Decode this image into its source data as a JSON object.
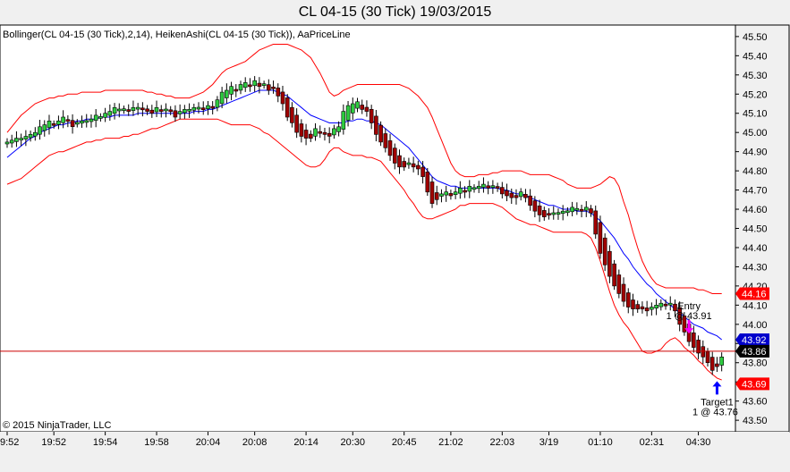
{
  "window": {
    "title": "CL 04-15 (30 Tick)  19/03/2015"
  },
  "indicators_label": "Bollinger(CL 04-15 (30 Tick),2,14), HeikenAshi(CL 04-15 (30 Tick)), AaPriceLine",
  "copyright": "© 2015 NinjaTrader, LLC",
  "colors": {
    "panel_bg": "#ffffff",
    "frame_bg": "#f0f0f0",
    "bull_body": "#2ecc40",
    "bear_body": "#a00000",
    "bollinger_band": "#ff0000",
    "bollinger_mid": "#0000ff",
    "price_line": "#cc0000",
    "entry_arrow": "#ff00ff",
    "target_arrow": "#0000ff"
  },
  "chart_data": {
    "type": "candlestick",
    "title": "CL 04-15 (30 Tick)  19/03/2015",
    "ylim": [
      43.44,
      45.56
    ],
    "y_ticks": [
      45.5,
      45.4,
      45.3,
      45.2,
      45.1,
      45.0,
      44.9,
      44.8,
      44.7,
      44.6,
      44.5,
      44.4,
      44.3,
      44.2,
      44.1,
      44.0,
      43.9,
      43.8,
      43.7,
      43.6,
      43.5
    ],
    "x_ticks": [
      {
        "label": "9:52",
        "bar": 0
      },
      {
        "label": "19:52",
        "bar": 10
      },
      {
        "label": "19:54",
        "bar": 21
      },
      {
        "label": "19:58",
        "bar": 32
      },
      {
        "label": "20:04",
        "bar": 43
      },
      {
        "label": "20:08",
        "bar": 53
      },
      {
        "label": "20:14",
        "bar": 64
      },
      {
        "label": "20:30",
        "bar": 74
      },
      {
        "label": "20:45",
        "bar": 85
      },
      {
        "label": "21:02",
        "bar": 95
      },
      {
        "label": "22:03",
        "bar": 106
      },
      {
        "label": "3/19",
        "bar": 116
      },
      {
        "label": "01:10",
        "bar": 127
      },
      {
        "label": "02:31",
        "bar": 138
      },
      {
        "label": "04:30",
        "bar": 148
      }
    ],
    "ha_close": [
      44.95,
      44.96,
      44.97,
      44.97,
      44.98,
      44.99,
      45.0,
      45.03,
      45.04,
      45.06,
      45.04,
      45.06,
      45.08,
      45.06,
      45.03,
      45.05,
      45.06,
      45.06,
      45.07,
      45.09,
      45.08,
      45.1,
      45.11,
      45.13,
      45.12,
      45.12,
      45.11,
      45.13,
      45.13,
      45.12,
      45.11,
      45.1,
      45.13,
      45.11,
      45.12,
      45.11,
      45.08,
      45.11,
      45.12,
      45.12,
      45.13,
      45.13,
      45.12,
      45.14,
      45.13,
      45.17,
      45.21,
      45.22,
      45.24,
      45.22,
      45.25,
      45.26,
      45.24,
      45.27,
      45.24,
      45.25,
      45.22,
      45.23,
      45.19,
      45.15,
      45.08,
      45.05,
      45.0,
      44.98,
      44.97,
      44.97,
      45.02,
      45.0,
      44.99,
      44.98,
      45.02,
      45.03,
      45.11,
      45.14,
      45.15,
      45.16,
      45.12,
      45.11,
      45.05,
      44.99,
      44.95,
      44.92,
      44.88,
      44.84,
      44.82,
      44.82,
      44.84,
      44.82,
      44.81,
      44.77,
      44.69,
      44.63,
      44.65,
      44.68,
      44.69,
      44.67,
      44.69,
      44.71,
      44.69,
      44.72,
      44.71,
      44.72,
      44.73,
      44.71,
      44.72,
      44.71,
      44.68,
      44.67,
      44.66,
      44.66,
      44.69,
      44.66,
      44.62,
      44.59,
      44.57,
      44.56,
      44.57,
      44.58,
      44.58,
      44.59,
      44.59,
      44.61,
      44.6,
      44.59,
      44.61,
      44.58,
      44.47,
      44.37,
      44.31,
      44.25,
      44.2,
      44.16,
      44.12,
      44.09,
      44.08,
      44.08,
      44.08,
      44.07,
      44.09,
      44.1,
      44.11,
      44.1,
      44.11,
      44.07,
      44.0,
      43.96,
      43.91,
      43.88,
      43.85,
      43.83,
      43.8,
      43.76,
      43.78,
      43.83
    ],
    "bb_upper": [
      45.0,
      45.03,
      45.06,
      45.09,
      45.11,
      45.13,
      45.15,
      45.16,
      45.17,
      45.18,
      45.18,
      45.19,
      45.19,
      45.2,
      45.2,
      45.2,
      45.21,
      45.21,
      45.21,
      45.21,
      45.21,
      45.22,
      45.22,
      45.22,
      45.22,
      45.22,
      45.22,
      45.22,
      45.22,
      45.22,
      45.21,
      45.21,
      45.2,
      45.2,
      45.19,
      45.19,
      45.18,
      45.18,
      45.18,
      45.18,
      45.19,
      45.2,
      45.21,
      45.23,
      45.25,
      45.28,
      45.31,
      45.33,
      45.34,
      45.35,
      45.36,
      45.37,
      45.39,
      45.41,
      45.43,
      45.44,
      45.45,
      45.46,
      45.46,
      45.46,
      45.46,
      45.45,
      45.44,
      45.43,
      45.41,
      45.39,
      45.35,
      45.31,
      45.26,
      45.21,
      45.19,
      45.2,
      45.22,
      45.23,
      45.24,
      45.25,
      45.25,
      45.25,
      45.25,
      45.25,
      45.25,
      45.25,
      45.25,
      45.25,
      45.25,
      45.24,
      45.23,
      45.21,
      45.19,
      45.16,
      45.13,
      45.08,
      45.02,
      44.96,
      44.9,
      44.84,
      44.8,
      44.78,
      44.77,
      44.77,
      44.77,
      44.78,
      44.78,
      44.78,
      44.79,
      44.79,
      44.8,
      44.8,
      44.8,
      44.8,
      44.8,
      44.79,
      44.78,
      44.78,
      44.78,
      44.78,
      44.78,
      44.77,
      44.76,
      44.75,
      44.73,
      44.72,
      44.71,
      44.71,
      44.71,
      44.71,
      44.72,
      44.73,
      44.75,
      44.77,
      44.76,
      44.72,
      44.64,
      44.57,
      44.48,
      44.4,
      44.33,
      44.28,
      44.24,
      44.21,
      44.2,
      44.19,
      44.19,
      44.19,
      44.19,
      44.19,
      44.19,
      44.19,
      44.18,
      44.18,
      44.17,
      44.16,
      44.16,
      44.16
    ],
    "bb_mid": [
      44.87,
      44.89,
      44.91,
      44.93,
      44.95,
      44.97,
      44.98,
      45.0,
      45.01,
      45.02,
      45.03,
      45.04,
      45.04,
      45.05,
      45.05,
      45.06,
      45.06,
      45.07,
      45.07,
      45.07,
      45.08,
      45.08,
      45.08,
      45.09,
      45.09,
      45.09,
      45.09,
      45.09,
      45.1,
      45.1,
      45.1,
      45.1,
      45.1,
      45.1,
      45.1,
      45.1,
      45.1,
      45.1,
      45.1,
      45.1,
      45.11,
      45.11,
      45.11,
      45.12,
      45.12,
      45.13,
      45.14,
      45.15,
      45.16,
      45.17,
      45.18,
      45.19,
      45.2,
      45.21,
      45.22,
      45.22,
      45.22,
      45.22,
      45.21,
      45.2,
      45.19,
      45.17,
      45.15,
      45.13,
      45.11,
      45.09,
      45.08,
      45.07,
      45.06,
      45.05,
      45.05,
      45.05,
      45.05,
      45.06,
      45.06,
      45.07,
      45.07,
      45.06,
      45.06,
      45.05,
      45.04,
      45.02,
      45.0,
      44.98,
      44.96,
      44.94,
      44.92,
      44.89,
      44.86,
      44.83,
      44.8,
      44.77,
      44.75,
      44.74,
      44.73,
      44.72,
      44.72,
      44.71,
      44.71,
      44.71,
      44.71,
      44.71,
      44.71,
      44.71,
      44.71,
      44.71,
      44.7,
      44.7,
      44.69,
      44.68,
      44.68,
      44.67,
      44.66,
      44.65,
      44.64,
      44.63,
      44.62,
      44.62,
      44.61,
      44.6,
      44.6,
      44.6,
      44.59,
      44.59,
      44.59,
      44.58,
      44.56,
      44.54,
      44.51,
      44.48,
      44.45,
      44.41,
      44.37,
      44.34,
      44.3,
      44.27,
      44.24,
      44.21,
      44.19,
      44.16,
      44.14,
      44.12,
      44.1,
      44.08,
      44.06,
      44.04,
      44.02,
      44.0,
      43.99,
      43.98,
      43.96,
      43.95,
      43.94,
      43.92
    ],
    "bb_lower": [
      44.73,
      44.74,
      44.75,
      44.76,
      44.78,
      44.8,
      44.82,
      44.84,
      44.86,
      44.88,
      44.89,
      44.9,
      44.9,
      44.91,
      44.92,
      44.93,
      44.94,
      44.95,
      44.95,
      44.96,
      44.96,
      44.97,
      44.97,
      44.97,
      44.97,
      44.98,
      44.98,
      44.99,
      44.99,
      45.0,
      45.01,
      45.02,
      45.02,
      45.03,
      45.04,
      45.05,
      45.06,
      45.07,
      45.07,
      45.07,
      45.07,
      45.07,
      45.07,
      45.07,
      45.07,
      45.07,
      45.06,
      45.05,
      45.04,
      45.04,
      45.04,
      45.04,
      45.04,
      45.03,
      45.02,
      45.0,
      44.99,
      44.97,
      44.95,
      44.93,
      44.91,
      44.89,
      44.87,
      44.85,
      44.83,
      44.82,
      44.82,
      44.83,
      44.86,
      44.9,
      44.92,
      44.92,
      44.9,
      44.89,
      44.88,
      44.88,
      44.88,
      44.87,
      44.87,
      44.86,
      44.85,
      44.82,
      44.79,
      44.76,
      44.73,
      44.7,
      44.66,
      44.63,
      44.59,
      44.56,
      44.55,
      44.55,
      44.56,
      44.57,
      44.58,
      44.59,
      44.6,
      44.62,
      44.62,
      44.63,
      44.63,
      44.63,
      44.63,
      44.63,
      44.63,
      44.62,
      44.61,
      44.59,
      44.57,
      44.55,
      44.54,
      44.53,
      44.52,
      44.52,
      44.51,
      44.5,
      44.49,
      44.48,
      44.48,
      44.48,
      44.48,
      44.48,
      44.48,
      44.48,
      44.47,
      44.45,
      44.4,
      44.33,
      44.25,
      44.17,
      44.1,
      44.05,
      44.01,
      43.98,
      43.94,
      43.9,
      43.86,
      43.85,
      43.85,
      43.86,
      43.87,
      43.9,
      43.92,
      43.93,
      43.91,
      43.88,
      43.86,
      43.84,
      43.81,
      43.79,
      43.76,
      43.74,
      43.72,
      43.71
    ],
    "price_line": 43.86,
    "price_labels": [
      {
        "text": "44.16",
        "value": 44.16,
        "bg": "#ff0000",
        "fg": "#ffffff"
      },
      {
        "text": "43.92",
        "value": 43.92,
        "bg": "#0000cc",
        "fg": "#ffffff"
      },
      {
        "text": "43.86",
        "value": 43.86,
        "bg": "#000000",
        "fg": "#ffffff"
      },
      {
        "text": "43.69",
        "value": 43.69,
        "bg": "#ff0000",
        "fg": "#ffffff"
      }
    ],
    "annotations": [
      {
        "id": "entry",
        "line1": "Entry",
        "line2": "1 @ 43.91",
        "bar": 146,
        "value": 43.91,
        "arrow": "down"
      },
      {
        "id": "target",
        "line1": "Target1",
        "line2": "1 @ 43.76",
        "bar": 152,
        "value": 43.76,
        "arrow": "up"
      }
    ]
  }
}
